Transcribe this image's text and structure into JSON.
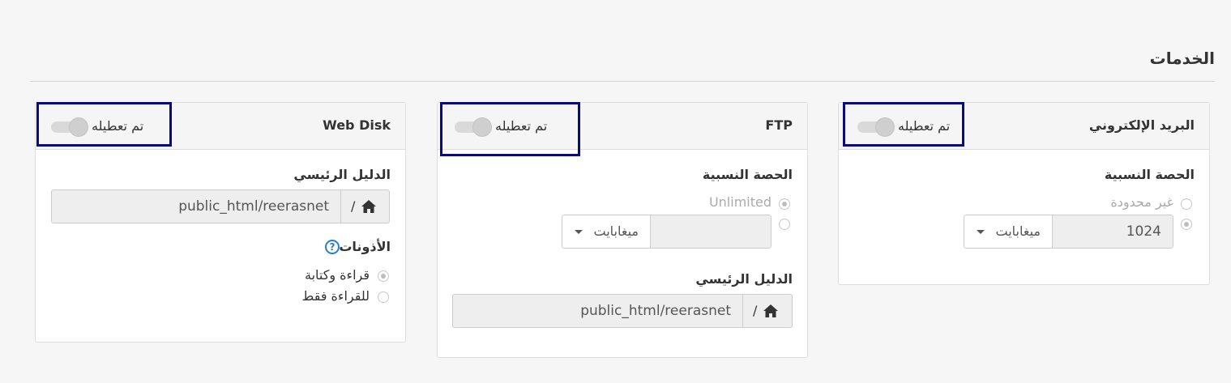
{
  "section": {
    "title": "الخدمات"
  },
  "email": {
    "title": "البريد الإلكتروني",
    "toggle_label": "تم تعطيله",
    "quota_label": "الحصة النسبية",
    "option_unlimited": "غير محدودة",
    "quota_value": "1024",
    "unit": "ميغابايت"
  },
  "ftp": {
    "title": "FTP",
    "toggle_label": "تم تعطيله",
    "quota_label": "الحصة النسبية",
    "option_unlimited": "Unlimited",
    "quota_value": "",
    "unit": "ميغابايت",
    "home_label": "الدليل الرئيسي",
    "home_prefix": "/",
    "home_value": "public_html/reerasnet"
  },
  "webdisk": {
    "title": "Web Disk",
    "toggle_label": "تم تعطيله",
    "home_label": "الدليل الرئيسي",
    "home_prefix": "/",
    "home_value": "public_html/reerasnet",
    "permissions_label": "الأذونات",
    "help_glyph": "?",
    "perm_read_write": "قراءة وكتابة",
    "perm_read_only": "للقراءة فقط"
  },
  "icons": {
    "home": "home-icon",
    "help": "help-icon",
    "caret": "caret-down-icon"
  },
  "colors": {
    "highlight_border": "#0a0a7c",
    "help_blue": "#2a7bd6"
  }
}
